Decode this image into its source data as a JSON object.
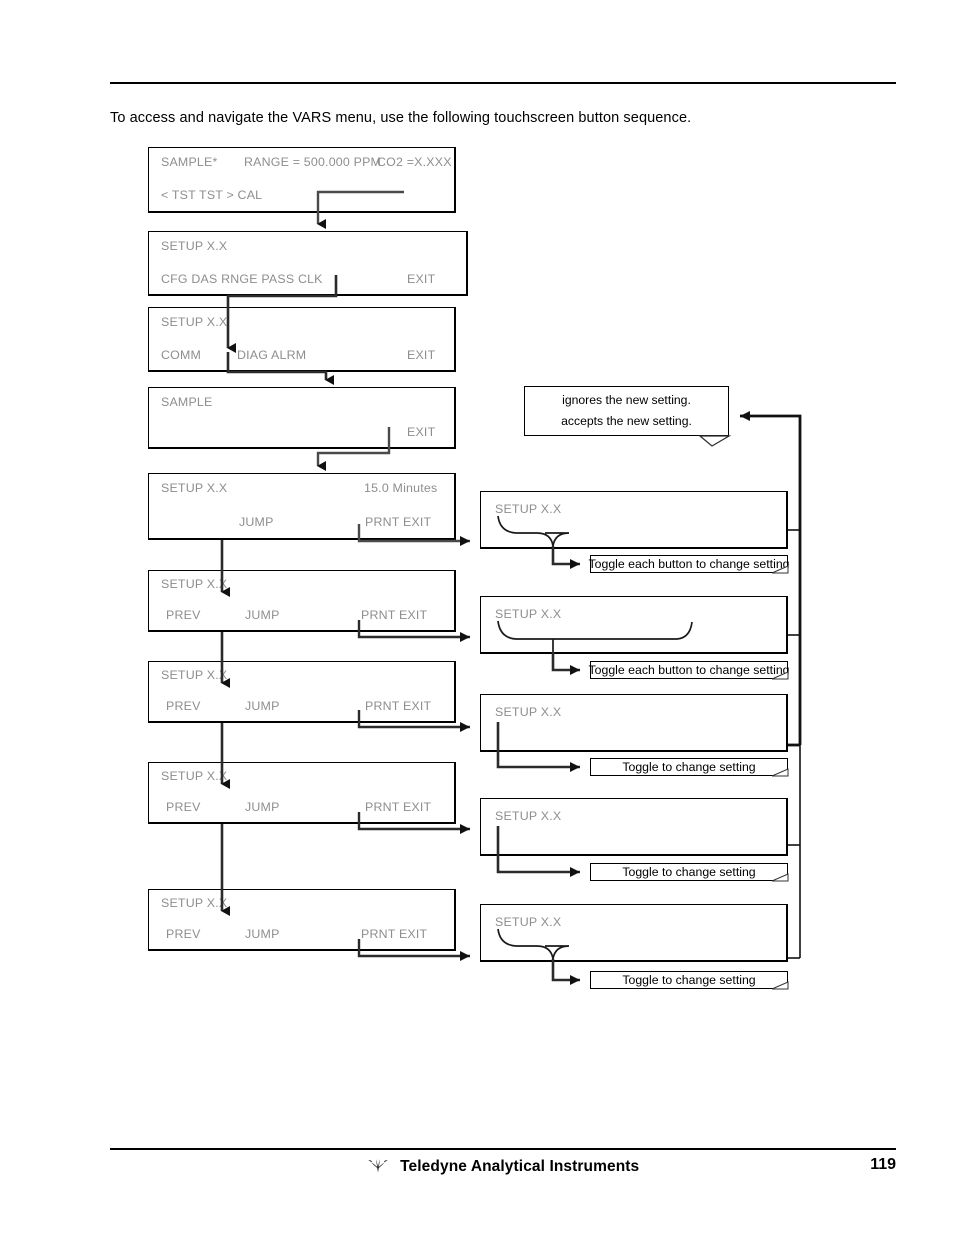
{
  "page": {
    "intro_text": "To access and navigate the VARS menu, use the following touchscreen button sequence.",
    "page_number": "119",
    "footer_company": "Teledyne Analytical Instruments"
  },
  "screens": [
    {
      "id": "sample-status",
      "title": "SAMPLE*",
      "range": "RANGE = 500.000 PPM",
      "conc": "CO2 =X.XXX",
      "buttons": "< TST  TST >  CAL"
    },
    {
      "id": "setup-main",
      "title": "SETUP X.X",
      "buttons_left": "CFG  DAS  RNGE  PASS  CLK",
      "buttons_right": "EXIT"
    },
    {
      "id": "setup-comm",
      "title": "SETUP X.X",
      "buttons_left": "COMM",
      "buttons_mid": "DIAG  ALRM",
      "buttons_right": "EXIT"
    },
    {
      "id": "sample-exit",
      "title": "SAMPLE",
      "buttons_right": "EXIT"
    },
    {
      "id": "setup-vars-1",
      "title": "SETUP X.X",
      "value": "15.0  Minutes",
      "buttons_mid": "JUMP",
      "buttons_right": "PRNT EXIT"
    },
    {
      "id": "setup-vars-2",
      "title": "SETUP X.X",
      "buttons_left": "PREV",
      "buttons_mid": "JUMP",
      "buttons_right": "PRNT   EXIT"
    },
    {
      "id": "setup-vars-3",
      "title": "SETUP X.X",
      "buttons_left": "PREV",
      "buttons_mid": "JUMP",
      "buttons_right": "PRNT EXIT"
    },
    {
      "id": "setup-vars-4",
      "title": "SETUP X.X",
      "buttons_left": "PREV",
      "buttons_mid": "JUMP",
      "buttons_right": "PRNT EXIT"
    },
    {
      "id": "setup-vars-5",
      "title": "SETUP X.X",
      "buttons_left": "PREV",
      "buttons_mid": "JUMP",
      "buttons_right": "PRNT   EXIT"
    }
  ],
  "detail_screens": [
    {
      "id": "detail-1",
      "title": "SETUP X.X"
    },
    {
      "id": "detail-2",
      "title": "SETUP X.X"
    },
    {
      "id": "detail-3",
      "title": "SETUP X.X"
    },
    {
      "id": "detail-4",
      "title": "SETUP X.X"
    },
    {
      "id": "detail-5",
      "title": "SETUP X.X"
    }
  ],
  "captions": [
    {
      "id": "caption-1",
      "text": "Toggle each button to change setting"
    },
    {
      "id": "caption-2",
      "text": "Toggle each button to change setting"
    },
    {
      "id": "caption-3",
      "text": "Toggle to change setting"
    },
    {
      "id": "caption-4",
      "text": "Toggle to change setting"
    },
    {
      "id": "caption-5",
      "text": "Toggle to change setting"
    }
  ],
  "note": {
    "line1": "ignores the new setting.",
    "line2": "accepts the new setting."
  }
}
